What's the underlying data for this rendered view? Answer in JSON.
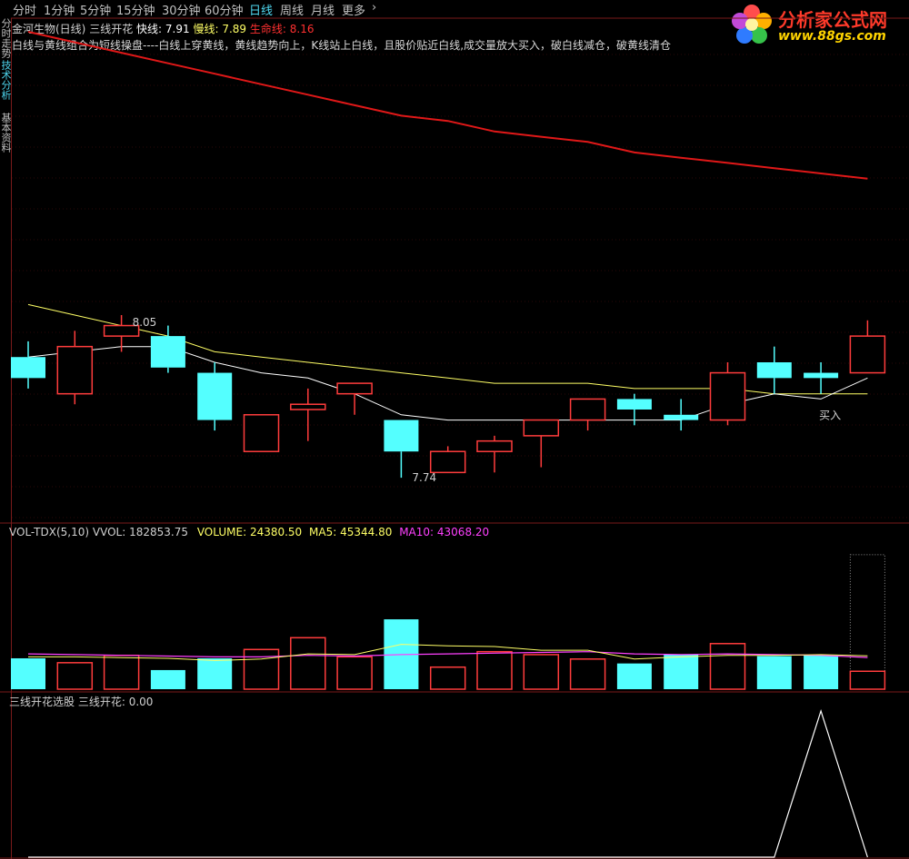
{
  "toolbar": {
    "tabs": [
      "分时",
      "1分钟",
      "5分钟",
      "15分钟",
      "30分钟",
      "60分钟",
      "日线",
      "周线",
      "月线",
      "更多"
    ],
    "active": "日线",
    "more_chevron": "›"
  },
  "side_tabs": [
    "分时走势",
    "技术分析",
    "基本资料"
  ],
  "logo": {
    "text": "分析家公式网",
    "url": "www.88gs.com",
    "icon": "flower-icon"
  },
  "main_panel": {
    "stock": "金河生物(日线)",
    "indicator": "三线开花",
    "fast_label": "快线:",
    "fast_value": "7.91",
    "slow_label": "慢线:",
    "slow_value": "7.89",
    "life_label": "生命线:",
    "life_value": "8.16",
    "description": "白线与黄线组合为短线操盘----白线上穿黄线，黄线趋势向上，K线站上白线，且股价贴近白线,成交量放大买入，破白线减仓，破黄线清仓",
    "high_label": "8.05",
    "low_label": "7.74",
    "buy_label": "买入"
  },
  "vol_panel": {
    "name": "VOL-TDX(5,10)",
    "vvol_label": "VVOL:",
    "vvol_value": "182853.75",
    "volume_label": "VOLUME:",
    "volume_value": "24380.50",
    "ma5_label": "MA5:",
    "ma5_value": "45344.80",
    "ma10_label": "MA10:",
    "ma10_value": "43068.20"
  },
  "signal_panel": {
    "name": "三线开花选股",
    "value_label": "三线开花:",
    "value": "0.00"
  },
  "colors": {
    "up": "#ff3c3c",
    "down": "#54ffff",
    "fast_line": "#ffffff",
    "slow_line": "#ffff66",
    "life_line": "#e01818",
    "ma5": "#ffff66",
    "ma10": "#ff40ff",
    "grid": "#7a1a1a",
    "tab_active": "#4fd8f0"
  },
  "chart_data": [
    {
      "type": "candlestick",
      "title": "金河生物(日线) 三线开花",
      "ylim": [
        7.7,
        8.6
      ],
      "candles": [
        {
          "o": 7.98,
          "h": 8.01,
          "l": 7.92,
          "c": 7.94
        },
        {
          "o": 7.91,
          "h": 8.03,
          "l": 7.89,
          "c": 8.0
        },
        {
          "o": 8.02,
          "h": 8.06,
          "l": 7.99,
          "c": 8.04
        },
        {
          "o": 8.02,
          "h": 8.04,
          "l": 7.95,
          "c": 7.96
        },
        {
          "o": 7.95,
          "h": 7.97,
          "l": 7.84,
          "c": 7.86
        },
        {
          "o": 7.8,
          "h": 7.87,
          "l": 7.8,
          "c": 7.87
        },
        {
          "o": 7.88,
          "h": 7.92,
          "l": 7.82,
          "c": 7.89
        },
        {
          "o": 7.91,
          "h": 7.92,
          "l": 7.87,
          "c": 7.93
        },
        {
          "o": 7.86,
          "h": 7.86,
          "l": 7.75,
          "c": 7.8
        },
        {
          "o": 7.76,
          "h": 7.81,
          "l": 7.76,
          "c": 7.8
        },
        {
          "o": 7.8,
          "h": 7.83,
          "l": 7.76,
          "c": 7.82
        },
        {
          "o": 7.83,
          "h": 7.86,
          "l": 7.77,
          "c": 7.86
        },
        {
          "o": 7.86,
          "h": 7.9,
          "l": 7.84,
          "c": 7.9
        },
        {
          "o": 7.9,
          "h": 7.91,
          "l": 7.85,
          "c": 7.88
        },
        {
          "o": 7.87,
          "h": 7.9,
          "l": 7.84,
          "c": 7.86
        },
        {
          "o": 7.86,
          "h": 7.97,
          "l": 7.85,
          "c": 7.95
        },
        {
          "o": 7.97,
          "h": 8.0,
          "l": 7.91,
          "c": 7.94
        },
        {
          "o": 7.95,
          "h": 7.97,
          "l": 7.91,
          "c": 7.94
        },
        {
          "o": 7.95,
          "h": 8.05,
          "l": 7.95,
          "c": 8.02
        }
      ],
      "fast_line": [
        7.98,
        7.99,
        8.0,
        8.0,
        7.97,
        7.95,
        7.94,
        7.91,
        7.87,
        7.86,
        7.86,
        7.86,
        7.86,
        7.86,
        7.86,
        7.89,
        7.91,
        7.9,
        7.94
      ],
      "slow_line": [
        8.08,
        8.06,
        8.04,
        8.02,
        7.99,
        7.98,
        7.97,
        7.96,
        7.95,
        7.94,
        7.93,
        7.93,
        7.93,
        7.92,
        7.92,
        7.92,
        7.91,
        7.91,
        7.91
      ],
      "life_line": [
        8.6,
        8.58,
        8.56,
        8.54,
        8.52,
        8.5,
        8.48,
        8.46,
        8.44,
        8.43,
        8.41,
        8.4,
        8.39,
        8.37,
        8.36,
        8.35,
        8.34,
        8.33,
        8.32
      ]
    },
    {
      "type": "bar",
      "title": "VOL-TDX(5,10)",
      "ylim": [
        0,
        200000
      ],
      "values": [
        42000,
        36000,
        46000,
        26000,
        42000,
        54000,
        70000,
        44000,
        95000,
        30000,
        51000,
        47000,
        41000,
        35000,
        47000,
        62000,
        45000,
        46000,
        24380.5
      ],
      "up": [
        false,
        true,
        true,
        false,
        false,
        true,
        true,
        true,
        false,
        true,
        true,
        true,
        true,
        false,
        false,
        true,
        false,
        false,
        true
      ],
      "vvol": 182853.75,
      "ma5": [
        44000,
        44000,
        43000,
        42000,
        39000,
        41000,
        48000,
        47000,
        61000,
        59000,
        58000,
        53000,
        53000,
        41000,
        44000,
        46000,
        46000,
        47000,
        45344.8
      ],
      "ma10": [
        48000,
        47000,
        46000,
        45000,
        44000,
        44000,
        46000,
        45000,
        47000,
        48000,
        49000,
        50000,
        51000,
        48000,
        47000,
        48000,
        47000,
        46000,
        43068.2
      ]
    },
    {
      "type": "line",
      "title": "三线开花选股",
      "ylim": [
        0,
        1
      ],
      "values": [
        0,
        0,
        0,
        0,
        0,
        0,
        0,
        0,
        0,
        0,
        0,
        0,
        0,
        0,
        0,
        0,
        0,
        1,
        0
      ]
    }
  ]
}
